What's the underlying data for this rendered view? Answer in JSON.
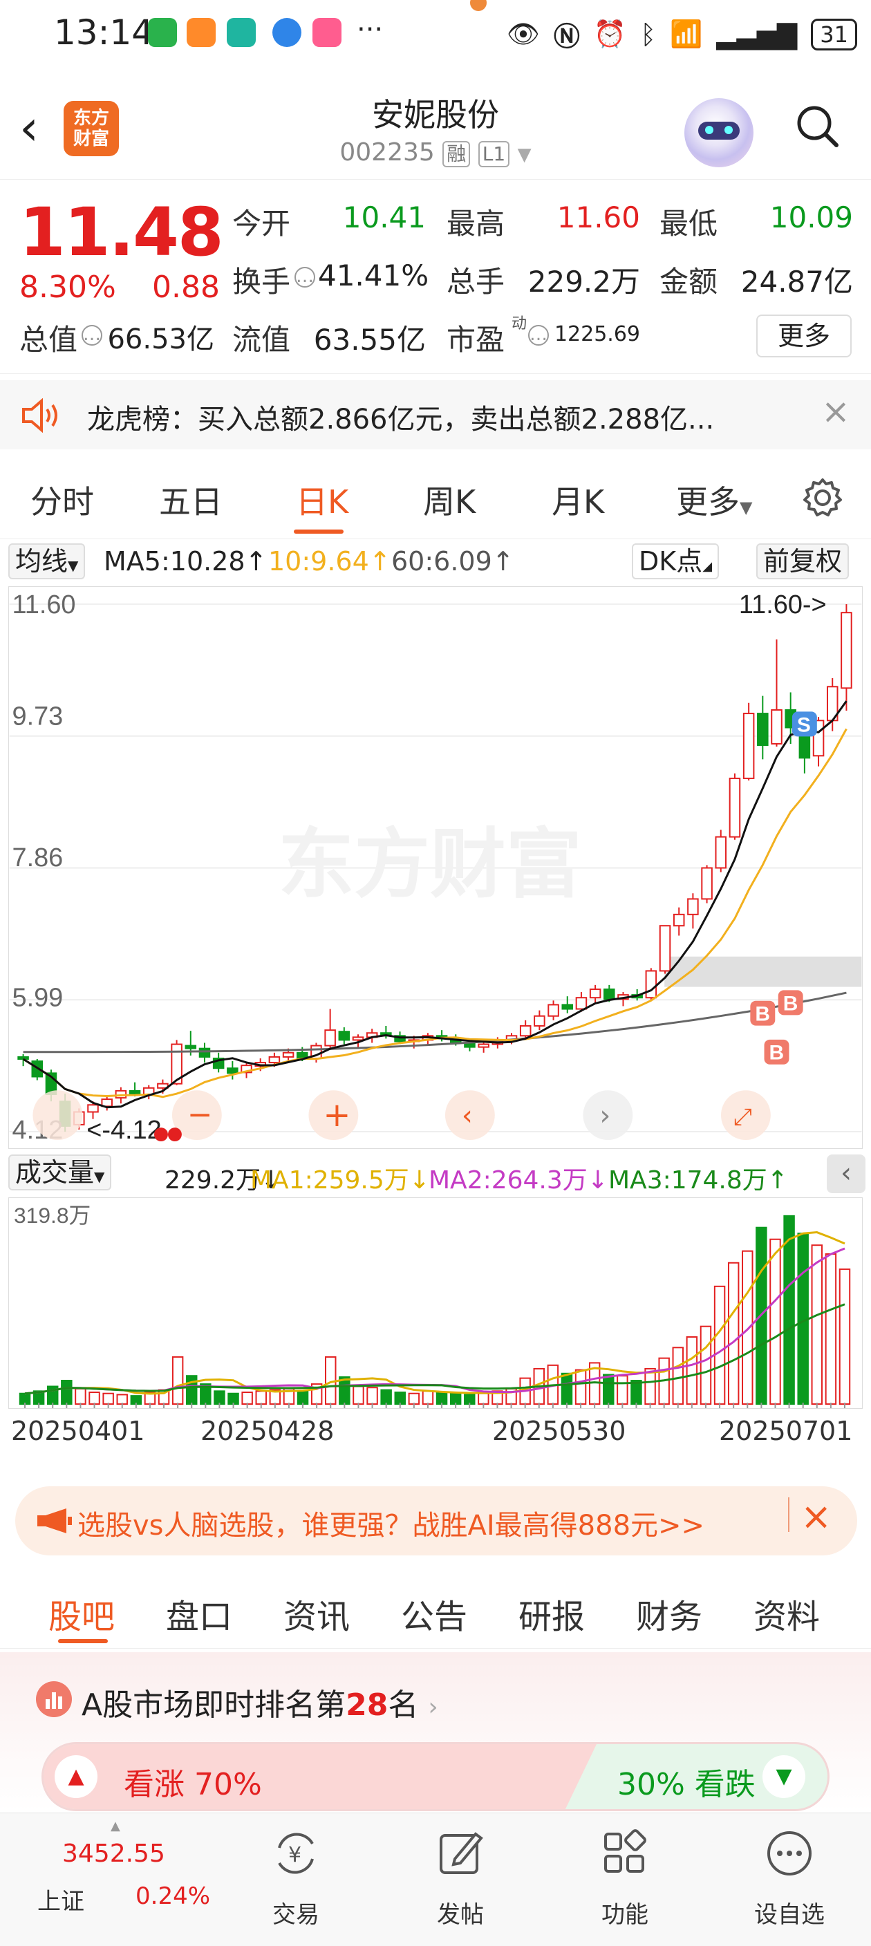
{
  "status_bar": {
    "time": "13:14",
    "battery": "31",
    "more": "···"
  },
  "header": {
    "back_icon": "chevron-left-icon",
    "logo_line1": "东方",
    "logo_line2": "财富",
    "title": "安妮股份",
    "code": "002235",
    "tag_rong": "融",
    "tag_level": "L1",
    "dropdown_icon": "caret-down-icon"
  },
  "quote": {
    "price": "11.48",
    "change_pct": "8.30%",
    "change_amt": "0.88",
    "open_label": "今开",
    "open_value": "10.41",
    "high_label": "最高",
    "high_value": "11.60",
    "low_label": "最低",
    "low_value": "10.09",
    "turnover_label": "换手",
    "turnover_value": "41.41%",
    "volume_label": "总手",
    "volume_value": "229.2万",
    "amount_label": "金额",
    "amount_value": "24.87亿",
    "mktcap_label": "总值",
    "mktcap_value": "66.53亿",
    "float_label": "流值",
    "float_value": "63.55亿",
    "pe_label": "市盈",
    "pe_sup": "动",
    "pe_value": "1225.69",
    "more_button": "更多"
  },
  "notice": {
    "text": "龙虎榜：买入总额2.866亿元，卖出总额2.288亿..."
  },
  "chart_tabs": [
    {
      "label": "分时"
    },
    {
      "label": "五日"
    },
    {
      "label": "日K"
    },
    {
      "label": "周K"
    },
    {
      "label": "月K"
    },
    {
      "label": "更多"
    }
  ],
  "active_tab": "日K",
  "indicator_bar": {
    "ma_selector": "均线",
    "ma5": "MA5:10.28↑",
    "ma10": "10:9.64↑",
    "ma60": "60:6.09↑",
    "dk_button": "DK点",
    "adjust_button": "前复权"
  },
  "kline_axis": {
    "y_top": "11.60",
    "y2": "9.73",
    "y3": "7.86",
    "y4": "5.99",
    "y_bottom": "4.12",
    "max_marker": "11.60->",
    "min_marker": "<-4.12",
    "watermark": "东方财富"
  },
  "volume_bar": {
    "selector": "成交量",
    "vol": "229.2万↓",
    "ma1": "MA1:259.5万↓",
    "ma2": "MA2:264.3万↓",
    "ma3": "MA3:174.8万↑",
    "y_max": "319.8万"
  },
  "dates": [
    "20250401",
    "20250428",
    "20250530",
    "20250701"
  ],
  "promo": {
    "text": "选股vs人脑选股，谁更强？战胜AI最高得888元>>"
  },
  "sub_tabs": [
    {
      "label": "股吧"
    },
    {
      "label": "盘口"
    },
    {
      "label": "资讯"
    },
    {
      "label": "公告"
    },
    {
      "label": "研报"
    },
    {
      "label": "财务"
    },
    {
      "label": "资料"
    }
  ],
  "rank": {
    "prefix": "A股市场即时排名第",
    "number": "28",
    "suffix": "名",
    "up_label": "看涨 70%",
    "down_label": "30% 看跌"
  },
  "bottom_nav": {
    "index_value": "3452.55",
    "index_name": "上证",
    "index_change": "0.24%",
    "items": [
      {
        "label": "交易",
        "icon": "yuan-exchange-icon"
      },
      {
        "label": "发帖",
        "icon": "edit-icon"
      },
      {
        "label": "功能",
        "icon": "grid-icon"
      },
      {
        "label": "设自选",
        "icon": "ellipsis-circle-icon"
      }
    ]
  },
  "colors": {
    "up": "#e32020",
    "down": "#0a9a1e",
    "accent": "#ef5a23",
    "ma5": "#111111",
    "ma10": "#f2b01e",
    "ma60": "#666666"
  },
  "chart_data": {
    "type": "candlestick",
    "title": "",
    "ylim": [
      4.12,
      11.6
    ],
    "yticks": [
      11.6,
      9.73,
      7.86,
      5.99,
      4.12
    ],
    "x_labels": [
      "20250401",
      "20250428",
      "20250530",
      "20250701"
    ],
    "candles": [
      [
        5.18,
        5.22,
        5.05,
        5.15
      ],
      [
        5.12,
        5.15,
        4.85,
        4.9
      ],
      [
        4.95,
        5.0,
        4.55,
        4.65
      ],
      [
        4.55,
        4.66,
        4.12,
        4.2
      ],
      [
        4.22,
        4.45,
        4.15,
        4.4
      ],
      [
        4.4,
        4.55,
        4.3,
        4.5
      ],
      [
        4.48,
        4.62,
        4.42,
        4.58
      ],
      [
        4.6,
        4.75,
        4.52,
        4.7
      ],
      [
        4.7,
        4.82,
        4.62,
        4.66
      ],
      [
        4.64,
        4.78,
        4.58,
        4.74
      ],
      [
        4.74,
        4.86,
        4.66,
        4.8
      ],
      [
        4.8,
        5.42,
        4.78,
        5.36
      ],
      [
        5.34,
        5.55,
        5.2,
        5.3
      ],
      [
        5.3,
        5.38,
        5.1,
        5.18
      ],
      [
        5.16,
        5.24,
        4.96,
        5.02
      ],
      [
        5.02,
        5.12,
        4.86,
        4.95
      ],
      [
        4.96,
        5.1,
        4.88,
        5.06
      ],
      [
        5.05,
        5.16,
        4.98,
        5.1
      ],
      [
        5.1,
        5.24,
        5.04,
        5.18
      ],
      [
        5.18,
        5.3,
        5.1,
        5.24
      ],
      [
        5.24,
        5.32,
        5.12,
        5.16
      ],
      [
        5.16,
        5.38,
        5.1,
        5.34
      ],
      [
        5.34,
        5.86,
        5.28,
        5.56
      ],
      [
        5.54,
        5.6,
        5.36,
        5.42
      ],
      [
        5.42,
        5.5,
        5.3,
        5.46
      ],
      [
        5.46,
        5.58,
        5.38,
        5.52
      ],
      [
        5.52,
        5.62,
        5.44,
        5.48
      ],
      [
        5.48,
        5.54,
        5.36,
        5.4
      ],
      [
        5.4,
        5.48,
        5.3,
        5.42
      ],
      [
        5.42,
        5.52,
        5.36,
        5.48
      ],
      [
        5.48,
        5.56,
        5.4,
        5.44
      ],
      [
        5.44,
        5.5,
        5.34,
        5.38
      ],
      [
        5.38,
        5.44,
        5.26,
        5.32
      ],
      [
        5.32,
        5.4,
        5.24,
        5.36
      ],
      [
        5.36,
        5.46,
        5.3,
        5.42
      ],
      [
        5.42,
        5.52,
        5.36,
        5.48
      ],
      [
        5.48,
        5.7,
        5.44,
        5.62
      ],
      [
        5.62,
        5.84,
        5.56,
        5.76
      ],
      [
        5.76,
        5.98,
        5.7,
        5.92
      ],
      [
        5.92,
        6.04,
        5.8,
        5.86
      ],
      [
        5.86,
        6.1,
        5.82,
        6.02
      ],
      [
        6.02,
        6.2,
        5.94,
        6.14
      ],
      [
        6.14,
        6.2,
        5.96,
        6.0
      ],
      [
        6.0,
        6.1,
        5.9,
        6.06
      ],
      [
        6.06,
        6.14,
        5.98,
        6.02
      ],
      [
        6.02,
        6.44,
        5.98,
        6.4
      ],
      [
        6.4,
        7.04,
        6.36,
        7.04
      ],
      [
        7.04,
        7.3,
        6.9,
        7.2
      ],
      [
        7.2,
        7.5,
        7.0,
        7.42
      ],
      [
        7.42,
        7.9,
        7.36,
        7.86
      ],
      [
        7.86,
        8.4,
        7.8,
        8.3
      ],
      [
        8.3,
        9.2,
        8.26,
        9.13
      ],
      [
        9.13,
        10.2,
        9.1,
        10.05
      ],
      [
        10.05,
        10.3,
        9.4,
        9.6
      ],
      [
        9.62,
        11.1,
        9.58,
        10.1
      ],
      [
        10.1,
        10.35,
        9.62,
        9.85
      ],
      [
        9.8,
        10.05,
        9.2,
        9.42
      ],
      [
        9.45,
        10.0,
        9.3,
        9.95
      ],
      [
        9.95,
        10.55,
        9.8,
        10.43
      ],
      [
        10.41,
        11.6,
        10.09,
        11.48
      ]
    ],
    "ma5_tail": 10.28,
    "ma10_tail": 9.64,
    "ma60_tail": 6.09,
    "volume_ylim": [
      0,
      319.8
    ],
    "volume_unit": "万"
  }
}
